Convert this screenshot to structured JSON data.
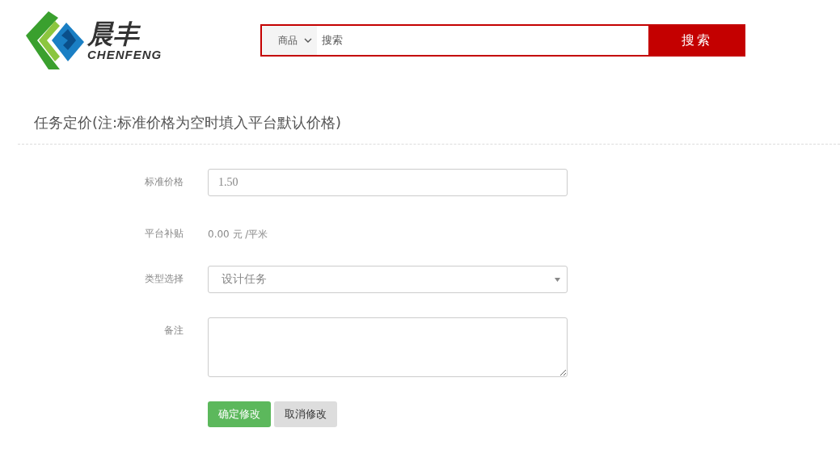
{
  "logo": {
    "name": "晨丰",
    "latin": "CHENFENG"
  },
  "search": {
    "category": "商品",
    "value": "搜索",
    "button": "搜索"
  },
  "section": {
    "title": "任务定价(注:标准价格为空时填入平台默认价格)"
  },
  "fields": [
    {
      "kind": "input",
      "label": "标准价格",
      "value": "1.50"
    },
    {
      "kind": "text",
      "label": "平台补贴",
      "value": "0.00 元 /平米"
    },
    {
      "kind": "select",
      "label": "类型选择",
      "value": "设计任务"
    },
    {
      "kind": "textarea",
      "label": "备注"
    }
  ],
  "buttons": [
    {
      "label": "确定修改",
      "kind": "primary"
    },
    {
      "label": "取消修改",
      "kind": "default"
    }
  ]
}
